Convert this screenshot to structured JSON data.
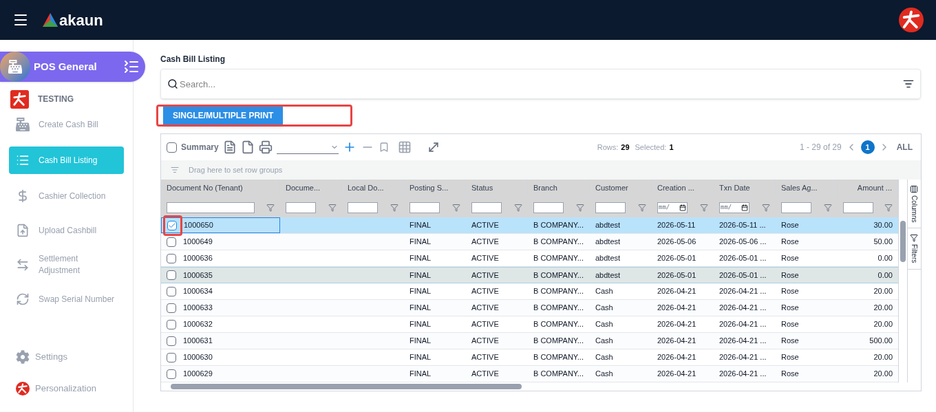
{
  "header": {
    "brand": "akaun"
  },
  "sidebar": {
    "app_title": "POS General",
    "tenant": "TESTING",
    "items": [
      {
        "label": "Create Cash Bill",
        "kind": "register",
        "selected": false
      },
      {
        "label": "Cash Bill Listing",
        "kind": "list",
        "selected": true
      },
      {
        "label": "Cashier Collection",
        "kind": "dollar",
        "selected": false
      },
      {
        "label": "Upload Cashbill",
        "kind": "upload",
        "selected": false
      },
      {
        "label": "Settlement Adjustment",
        "kind": "swap",
        "selected": false
      },
      {
        "label": "Swap Serial Number",
        "kind": "refresh",
        "selected": false
      }
    ],
    "bottom_items": [
      {
        "label": "Settings",
        "kind": "gear"
      },
      {
        "label": "Personalization",
        "kind": "logo"
      }
    ]
  },
  "page_title": "Cash Bill Listing",
  "search": {
    "placeholder": "Search..."
  },
  "print_button": {
    "label": "SINGLE/MULTIPLE PRINT",
    "annotated": true
  },
  "toolbar": {
    "summary_label": "Summary",
    "summary_checked": false,
    "rows_label": "Rows:",
    "rows_count": "29",
    "selected_label": "Selected:",
    "selected_count": "1",
    "range": "1 - 29 of 29",
    "pages": [
      {
        "label": "1",
        "selected": true
      }
    ],
    "all_label": "ALL"
  },
  "group_bar": {
    "placeholder": "Drag here to set row groups"
  },
  "table": {
    "columns": [
      {
        "label": "Document No (Tenant)",
        "kind": "text"
      },
      {
        "label": "Docume...",
        "kind": "text"
      },
      {
        "label": "Local Do...",
        "kind": "text"
      },
      {
        "label": "Posting S...",
        "kind": "text"
      },
      {
        "label": "Status",
        "kind": "text"
      },
      {
        "label": "Branch",
        "kind": "text"
      },
      {
        "label": "Customer",
        "kind": "text"
      },
      {
        "label": "Creation ...",
        "kind": "date",
        "placeholder": "mm/"
      },
      {
        "label": "Txn Date",
        "kind": "date",
        "placeholder": "mm/"
      },
      {
        "label": "Sales Ag...",
        "kind": "text"
      },
      {
        "label": "Amount ...",
        "kind": "number"
      }
    ],
    "rows": [
      {
        "selected": true,
        "hovered": false,
        "annotated": true,
        "cells": [
          "1000650",
          "",
          "",
          "FINAL",
          "ACTIVE",
          "B COMPANY...",
          "abdtest",
          "2026-05-11",
          "2026-05-11 ...",
          "Rose",
          "30.00"
        ]
      },
      {
        "selected": false,
        "hovered": false,
        "annotated": false,
        "cells": [
          "1000649",
          "",
          "",
          "FINAL",
          "ACTIVE",
          "B COMPANY...",
          "abdtest",
          "2026-05-06",
          "2026-05-06 ...",
          "Rose",
          "50.00"
        ]
      },
      {
        "selected": false,
        "hovered": false,
        "annotated": false,
        "cells": [
          "1000636",
          "",
          "",
          "FINAL",
          "ACTIVE",
          "B COMPANY...",
          "abdtest",
          "2026-05-01",
          "2026-05-01 ...",
          "Rose",
          "0.00"
        ]
      },
      {
        "selected": false,
        "hovered": true,
        "annotated": false,
        "cells": [
          "1000635",
          "",
          "",
          "FINAL",
          "ACTIVE",
          "B COMPANY...",
          "abdtest",
          "2026-05-01",
          "2026-05-01 ...",
          "Rose",
          "0.00"
        ]
      },
      {
        "selected": false,
        "hovered": false,
        "annotated": false,
        "cells": [
          "1000634",
          "",
          "",
          "FINAL",
          "ACTIVE",
          "B COMPANY...",
          "Cash",
          "2026-04-21",
          "2026-04-21 ...",
          "Rose",
          "20.00"
        ]
      },
      {
        "selected": false,
        "hovered": false,
        "annotated": false,
        "cells": [
          "1000633",
          "",
          "",
          "FINAL",
          "ACTIVE",
          "B COMPANY...",
          "Cash",
          "2026-04-21",
          "2026-04-21 ...",
          "Rose",
          "20.00"
        ]
      },
      {
        "selected": false,
        "hovered": false,
        "annotated": false,
        "cells": [
          "1000632",
          "",
          "",
          "FINAL",
          "ACTIVE",
          "B COMPANY...",
          "Cash",
          "2026-04-21",
          "2026-04-21 ...",
          "Rose",
          "20.00"
        ]
      },
      {
        "selected": false,
        "hovered": false,
        "annotated": false,
        "cells": [
          "1000631",
          "",
          "",
          "FINAL",
          "ACTIVE",
          "B COMPANY...",
          "Cash",
          "2026-04-21",
          "2026-04-21 ...",
          "Rose",
          "500.00"
        ]
      },
      {
        "selected": false,
        "hovered": false,
        "annotated": false,
        "cells": [
          "1000630",
          "",
          "",
          "FINAL",
          "ACTIVE",
          "B COMPANY...",
          "Cash",
          "2026-04-21",
          "2026-04-21 ...",
          "Rose",
          "20.00"
        ]
      },
      {
        "selected": false,
        "hovered": false,
        "annotated": false,
        "cells": [
          "1000629",
          "",
          "",
          "FINAL",
          "ACTIVE",
          "B COMPANY...",
          "Cash",
          "2026-04-21",
          "2026-04-21 ...",
          "Rose",
          "20.00"
        ]
      }
    ]
  },
  "side_panel": [
    {
      "label": "Columns",
      "kind": "columns"
    },
    {
      "label": "Filters",
      "kind": "filter"
    }
  ]
}
